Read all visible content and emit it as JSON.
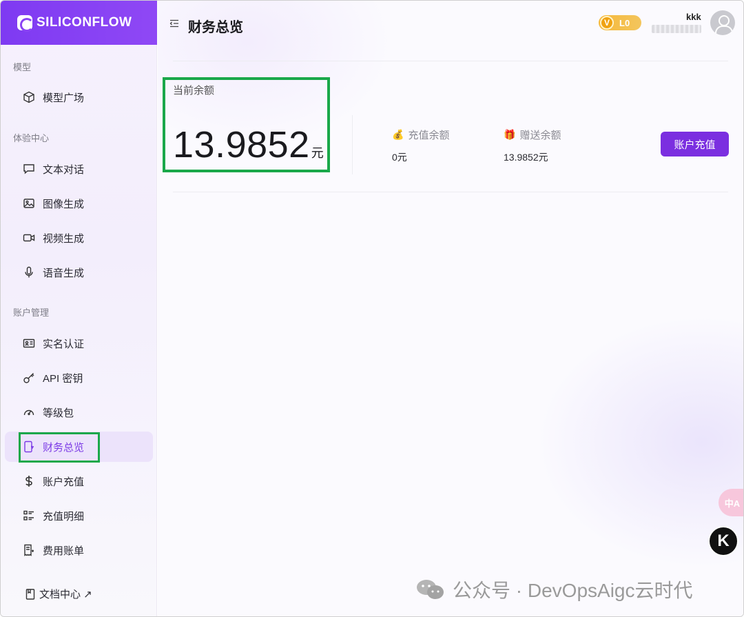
{
  "app": {
    "logo_text": "SILICONFLOW"
  },
  "sidebar": {
    "sections": [
      {
        "label": "模型"
      },
      {
        "label": "体验中心"
      },
      {
        "label": "账户管理"
      }
    ],
    "items": [
      {
        "label": "模型广场",
        "icon": "cube-icon"
      },
      {
        "label": "文本对话",
        "icon": "chat-bubble-icon"
      },
      {
        "label": "图像生成",
        "icon": "image-icon"
      },
      {
        "label": "视频生成",
        "icon": "video-camera-icon"
      },
      {
        "label": "语音生成",
        "icon": "microphone-icon"
      },
      {
        "label": "实名认证",
        "icon": "id-card-icon"
      },
      {
        "label": "API 密钥",
        "icon": "key-icon"
      },
      {
        "label": "等级包",
        "icon": "gauge-icon"
      },
      {
        "label": "财务总览",
        "icon": "wallet-icon",
        "active": true
      },
      {
        "label": "账户充值",
        "icon": "dollar-icon"
      },
      {
        "label": "充值明细",
        "icon": "list-icon"
      },
      {
        "label": "费用账单",
        "icon": "bill-icon"
      }
    ],
    "docs_link": "文档中心 ↗"
  },
  "header": {
    "title": "财务总览",
    "level_badge": "L0",
    "level_mark": "V",
    "user_name": "kkk"
  },
  "balance": {
    "label": "当前余额",
    "amount": "13.9852",
    "unit": "元",
    "recharge_label": "充值余额",
    "recharge_value": "0元",
    "gift_label": "赠送余额",
    "gift_value": "13.9852元",
    "action_button": "账户充值"
  },
  "floating": {
    "translate_label": "中A",
    "k_label": "K"
  },
  "watermark": {
    "text": "公众号 · DevOpsAigc云时代"
  },
  "colors": {
    "accent": "#7b2fe0",
    "highlight_box": "#1aa84a",
    "badge_gold": "#f6b93a"
  }
}
